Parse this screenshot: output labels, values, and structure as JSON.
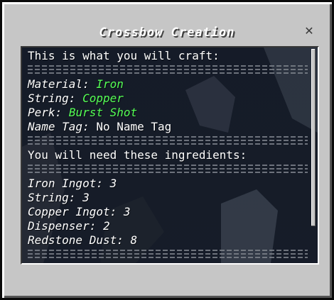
{
  "window": {
    "title": "Crossbow Creation"
  },
  "summary": {
    "heading": "This is what you will craft:",
    "fields": [
      {
        "label": "Material:",
        "value": "Iron",
        "value_color": "#55ff55"
      },
      {
        "label": "String:",
        "value": "Copper",
        "value_color": "#55ff55"
      },
      {
        "label": "Perk:",
        "value": "Burst Shot",
        "value_color": "#55ff55"
      },
      {
        "label": "Name Tag:",
        "value": "No Name Tag",
        "value_color": "#ffffff"
      }
    ]
  },
  "ingredients": {
    "heading": "You will need these ingredients:",
    "items": [
      {
        "label": "Iron Ingot:",
        "qty": "3"
      },
      {
        "label": "String:",
        "qty": "3"
      },
      {
        "label": "Copper Ingot:",
        "qty": "3"
      },
      {
        "label": "Dispenser:",
        "qty": "2"
      },
      {
        "label": "Redstone Dust:",
        "qty": "8"
      }
    ]
  },
  "icons": {
    "close": "close-icon"
  },
  "colors": {
    "accent_green": "#55ff55",
    "text": "#ffffff",
    "frame": "#c6c6c6"
  }
}
